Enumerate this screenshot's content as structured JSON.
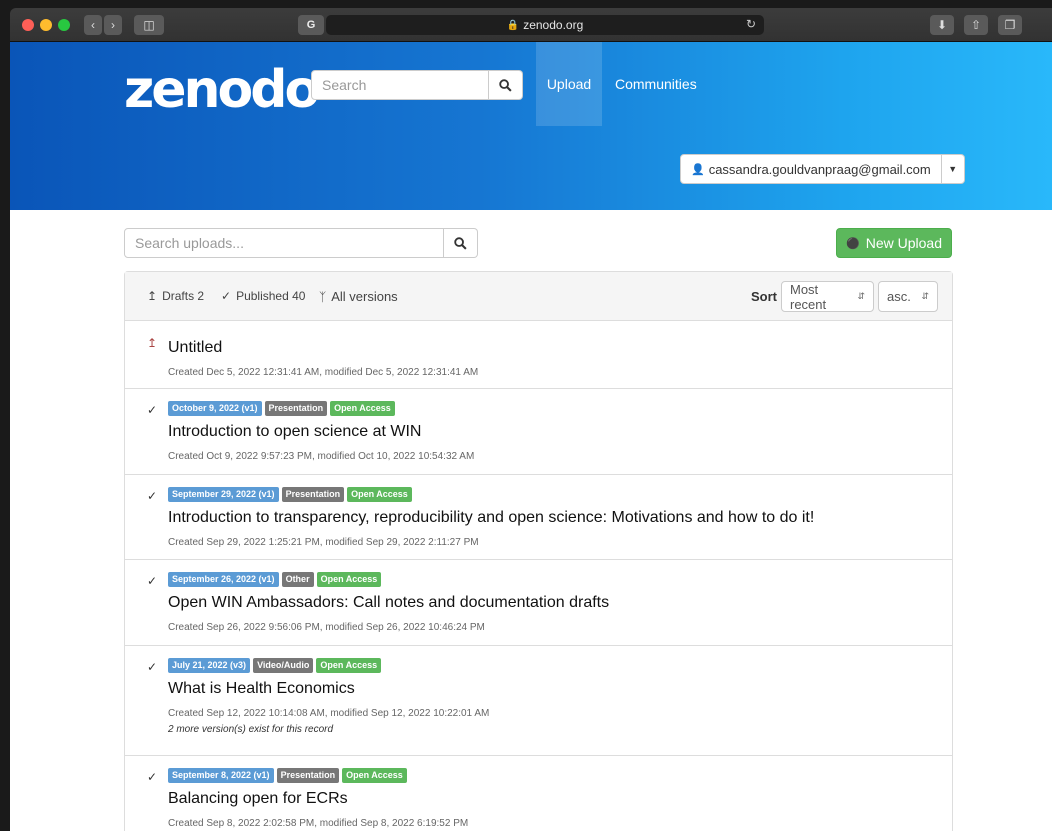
{
  "browser": {
    "url": "zenodo.org"
  },
  "header": {
    "logo": "zenodo",
    "search_placeholder": "Search",
    "nav_upload": "Upload",
    "nav_communities": "Communities",
    "user_email": "cassandra.gouldvanpraag@gmail.com"
  },
  "toolbar": {
    "search_placeholder": "Search uploads...",
    "new_upload_label": "New Upload"
  },
  "filters": {
    "drafts": "Drafts 2",
    "published": "Published 40",
    "all_versions": "All versions",
    "sort_label": "Sort",
    "sort_value": "Most recent",
    "order_value": "asc."
  },
  "records": [
    {
      "status": "draft",
      "title": "Untitled",
      "meta": "Created Dec 5, 2022 12:31:41 AM, modified Dec 5, 2022 12:31:41 AM"
    },
    {
      "status": "published",
      "date_label": "October 9, 2022 (v1)",
      "type_label": "Presentation",
      "access_label": "Open Access",
      "title": "Introduction to open science at WIN",
      "meta": "Created Oct 9, 2022 9:57:23 PM, modified Oct 10, 2022 10:54:32 AM"
    },
    {
      "status": "published",
      "date_label": "September 29, 2022 (v1)",
      "type_label": "Presentation",
      "access_label": "Open Access",
      "title": "Introduction to transparency, reproducibility and open science: Motivations and how to do it!",
      "meta": "Created Sep 29, 2022 1:25:21 PM, modified Sep 29, 2022 2:11:27 PM"
    },
    {
      "status": "published",
      "date_label": "September 26, 2022 (v1)",
      "type_label": "Other",
      "access_label": "Open Access",
      "title": "Open WIN Ambassadors: Call notes and documentation drafts",
      "meta": "Created Sep 26, 2022 9:56:06 PM, modified Sep 26, 2022 10:46:24 PM"
    },
    {
      "status": "published",
      "date_label": "July 21, 2022 (v3)",
      "type_label": "Video/Audio",
      "access_label": "Open Access",
      "title": "What is Health Economics",
      "meta": "Created Sep 12, 2022 10:14:08 AM, modified Sep 12, 2022 10:22:01 AM",
      "note": "2 more version(s) exist for this record"
    },
    {
      "status": "published",
      "date_label": "September 8, 2022 (v1)",
      "type_label": "Presentation",
      "access_label": "Open Access",
      "title": "Balancing open for ECRs",
      "meta": "Created Sep 8, 2022 2:02:58 PM, modified Sep 8, 2022 6:19:52 PM"
    }
  ],
  "colors": {
    "accent": "#1676d2",
    "success": "#5cb85c",
    "label_blue": "#5b9bd5",
    "label_gray": "#777777",
    "draft_icon": "#a94442"
  }
}
